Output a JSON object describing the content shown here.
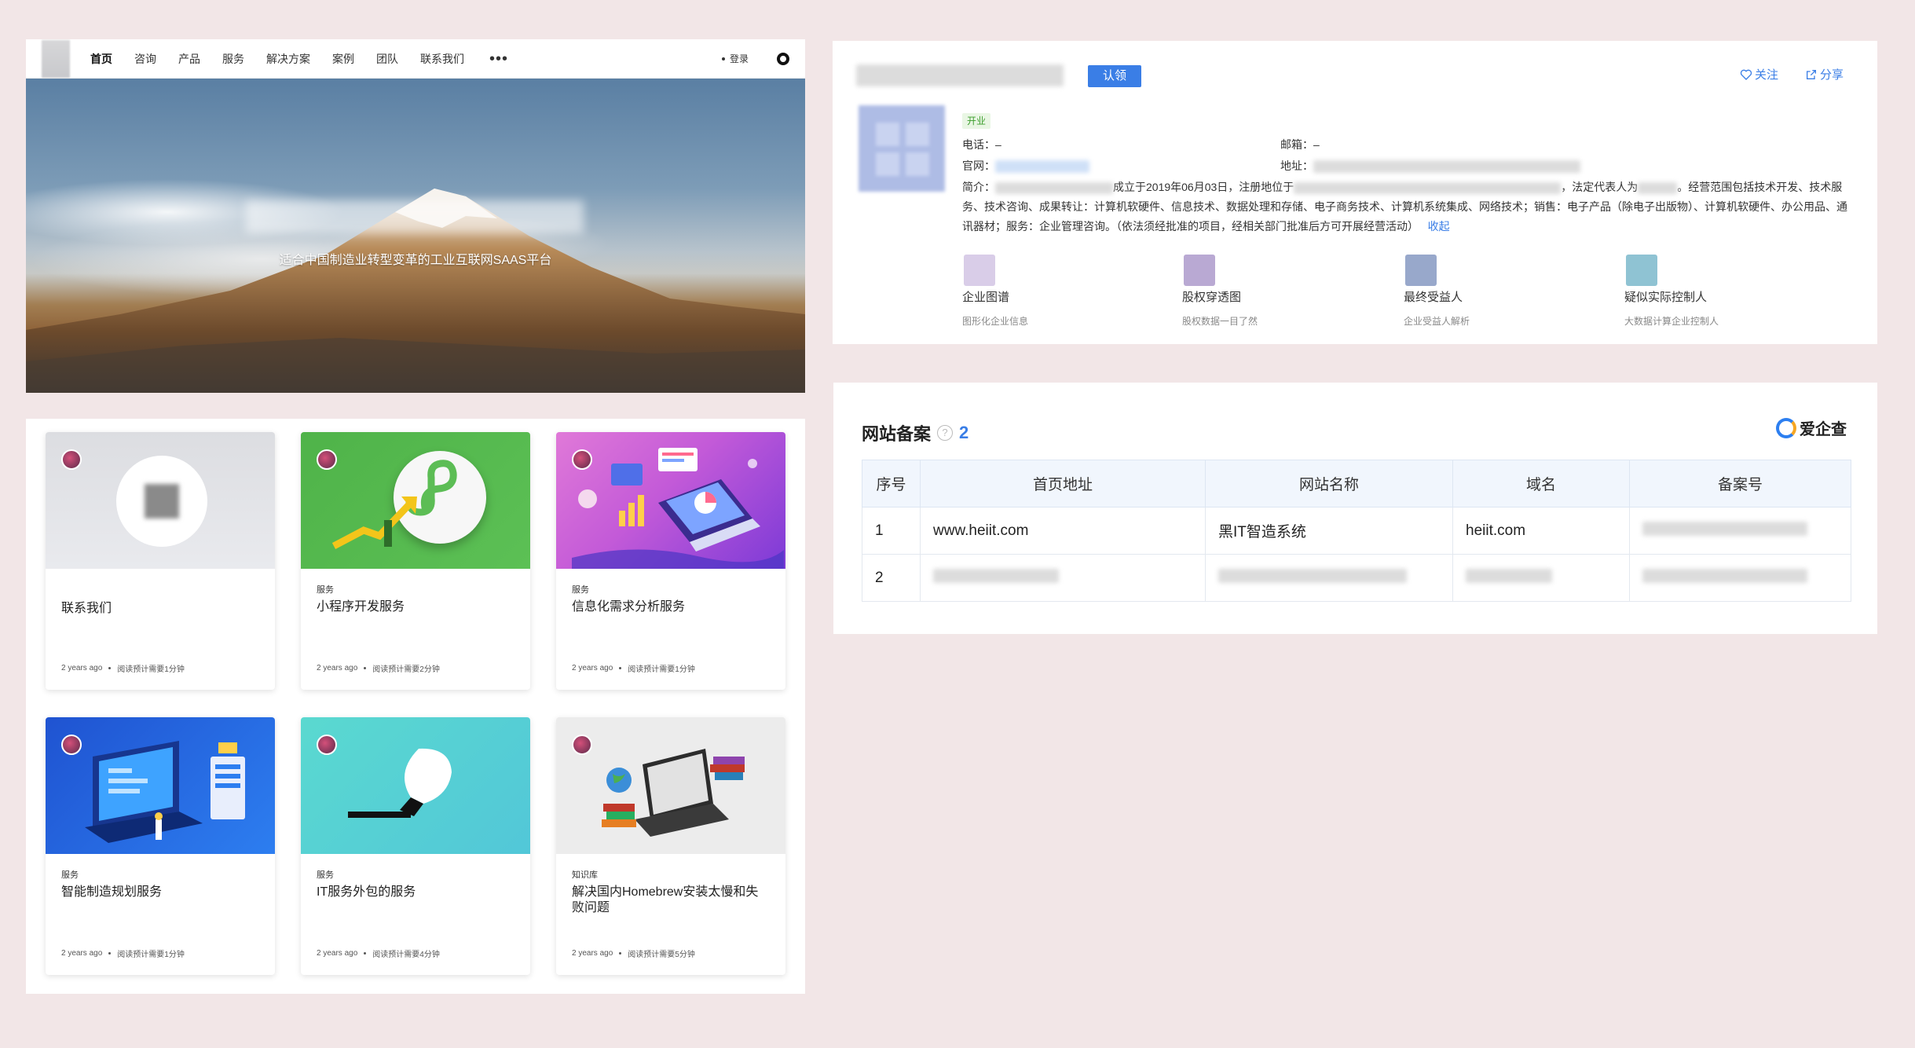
{
  "site": {
    "nav": [
      "首页",
      "咨询",
      "产品",
      "服务",
      "解决方案",
      "案例",
      "团队",
      "联系我们"
    ],
    "more": "•••",
    "login": "登录",
    "hero_subtitle": "适合中国制造业转型变革的工业互联网SAAS平台"
  },
  "cards": [
    {
      "category": "",
      "title": "联系我们",
      "time": "2 years ago",
      "read": "阅读预计需要1分钟"
    },
    {
      "category": "服务",
      "title": "小程序开发服务",
      "time": "2 years ago",
      "read": "阅读预计需要2分钟"
    },
    {
      "category": "服务",
      "title": "信息化需求分析服务",
      "time": "2 years ago",
      "read": "阅读预计需要1分钟"
    },
    {
      "category": "服务",
      "title": "智能制造规划服务",
      "time": "2 years ago",
      "read": "阅读预计需要1分钟"
    },
    {
      "category": "服务",
      "title": "IT服务外包的服务",
      "time": "2 years ago",
      "read": "阅读预计需要4分钟"
    },
    {
      "category": "知识库",
      "title": "解决国内Homebrew安装太慢和失败问题",
      "time": "2 years ago",
      "read": "阅读预计需要5分钟"
    }
  ],
  "company": {
    "claim": "认领",
    "follow": "关注",
    "share": "分享",
    "status": "开业",
    "phone_label": "电话：",
    "phone": "–",
    "email_label": "邮箱：",
    "email": "–",
    "website_label": "官网：",
    "address_label": "地址：",
    "intro_label": "简介：",
    "intro_part1": "成立于2019年06月03日，注册地位于",
    "intro_part2": "，法定代表人为",
    "intro_part3": "。经营范围包括技术开发、技术服务、技术咨询、成果转让：计算机软硬件、信息技术、数据处理和存储、电子商务技术、计算机系统集成、网络技术；销售：电子产品（除电子出版物）、计算机软硬件、办公用品、通讯器材；服务：企业管理咨询。（依法须经批准的项目，经相关部门批准后方可开展经营活动）",
    "collapse": "收起",
    "features": [
      {
        "name": "企业图谱",
        "desc": "图形化企业信息",
        "color": "#d9cde8"
      },
      {
        "name": "股权穿透图",
        "desc": "股权数据一目了然",
        "color": "#b9a9d3"
      },
      {
        "name": "最终受益人",
        "desc": "企业受益人解析",
        "color": "#98a8cb"
      },
      {
        "name": "疑似实际控制人",
        "desc": "大数据计算企业控制人",
        "color": "#8fc3d3"
      }
    ]
  },
  "icp": {
    "title": "网站备案",
    "help": "?",
    "count": "2",
    "brand": "爱企查",
    "headers": [
      "序号",
      "首页地址",
      "网站名称",
      "域名",
      "备案号"
    ],
    "rows": [
      {
        "idx": "1",
        "url": "www.heiit.com",
        "name": "黑IT智造系统",
        "domain": "heiit.com"
      },
      {
        "idx": "2",
        "url": "",
        "name": "",
        "domain": ""
      }
    ]
  }
}
